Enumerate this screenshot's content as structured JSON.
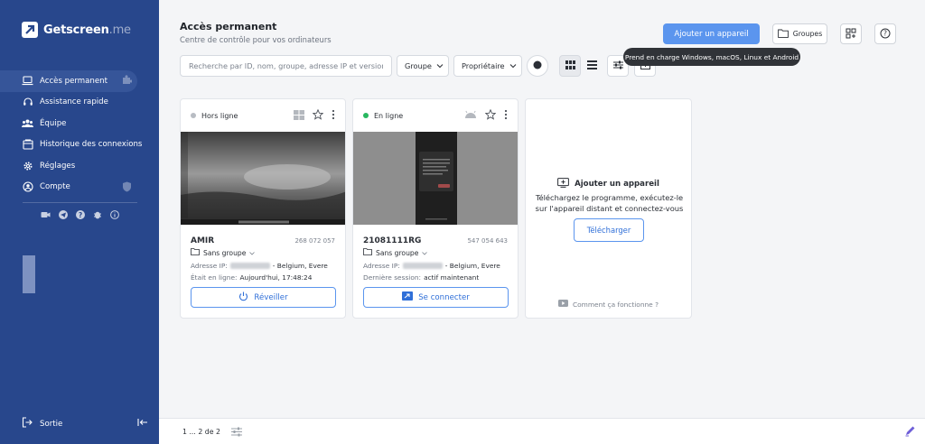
{
  "app": {
    "brand_name": "Getscreen",
    "brand_suffix": ".me"
  },
  "sidebar": {
    "items": [
      {
        "label": "Accès permanent",
        "icon": "laptop-icon"
      },
      {
        "label": "Assistance rapide",
        "icon": "headset-icon"
      },
      {
        "label": "Équipe",
        "icon": "team-icon"
      },
      {
        "label": "Historique des connexions",
        "icon": "history-icon"
      },
      {
        "label": "Réglages",
        "icon": "gear-icon"
      },
      {
        "label": "Compte",
        "icon": "account-icon"
      }
    ],
    "logout_label": "Sortie"
  },
  "header": {
    "title": "Accès permanent",
    "subtitle": "Centre de contrôle pour vos ordinateurs",
    "add_device_label": "Ajouter un appareil",
    "groups_label": "Groupes",
    "tooltip": "Prend en charge Windows, macOS, Linux et Android"
  },
  "toolbar": {
    "search_placeholder": "Recherche par ID, nom, groupe, adresse IP et version",
    "group_label": "Groupe",
    "owner_label": "Propriétaire"
  },
  "devices": [
    {
      "status": "Hors ligne",
      "status_color": "#b8bcc3",
      "name": "AMIR",
      "id": "268 072 057",
      "group": "Sans groupe",
      "ip_label": "Adresse IP:",
      "location": "- Belgium, Evere",
      "last_label": "Était en ligne:",
      "last_value": "Aujourd'hui, 17:48:24",
      "action_label": "Réveiller",
      "os_icon": "windows-icon"
    },
    {
      "status": "En ligne",
      "status_color": "#27b75f",
      "name": "21081111RG",
      "id": "547 054 643",
      "group": "Sans groupe",
      "ip_label": "Adresse IP:",
      "location": "- Belgium, Evere",
      "last_label": "Dernière session:",
      "last_value": "actif maintenant",
      "action_label": "Se connecter",
      "os_icon": "android-icon"
    }
  ],
  "add_card": {
    "title": "Ajouter un appareil",
    "description": "Téléchargez le programme, exécutez-le sur l'appareil distant et connectez-vous",
    "download_label": "Télécharger",
    "help_label": "Comment ça fonctionne ?"
  },
  "footer": {
    "pagination": "1 ... 2 de 2"
  },
  "colors": {
    "sidebar_bg": "#28478c",
    "accent": "#5b95ee",
    "online": "#27b75f",
    "offline": "#b8bcc3"
  }
}
